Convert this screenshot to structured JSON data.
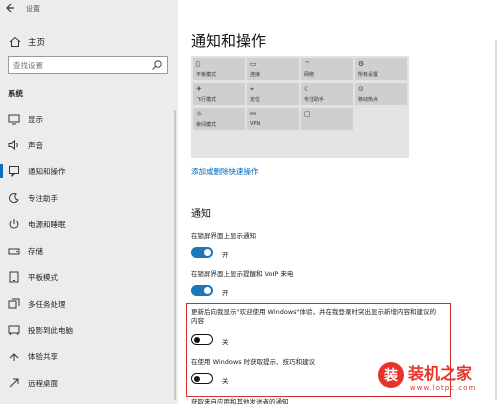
{
  "window": {
    "title": "设置"
  },
  "sidebar": {
    "home_label": "主页",
    "search_placeholder": "查找设置",
    "section_label": "系统",
    "items": [
      {
        "label": "显示",
        "icon": "display-icon"
      },
      {
        "label": "声音",
        "icon": "sound-icon"
      },
      {
        "label": "通知和操作",
        "icon": "notifications-icon",
        "selected": true
      },
      {
        "label": "专注助手",
        "icon": "focus-assist-icon"
      },
      {
        "label": "电源和睡眠",
        "icon": "power-icon"
      },
      {
        "label": "存储",
        "icon": "storage-icon"
      },
      {
        "label": "平板模式",
        "icon": "tablet-mode-icon"
      },
      {
        "label": "多任务处理",
        "icon": "multitasking-icon"
      },
      {
        "label": "投影到此电脑",
        "icon": "project-icon"
      },
      {
        "label": "体验共享",
        "icon": "shared-experiences-icon"
      },
      {
        "label": "远程桌面",
        "icon": "remote-desktop-icon"
      }
    ]
  },
  "main": {
    "title": "通知和操作",
    "quick_actions": [
      {
        "label": "平板模式"
      },
      {
        "label": "连接"
      },
      {
        "label": "网络"
      },
      {
        "label": "所有设置"
      },
      {
        "label": "飞行模式"
      },
      {
        "label": "定位"
      },
      {
        "label": "专注助手"
      },
      {
        "label": "移动热点"
      },
      {
        "label": "夜间模式"
      },
      {
        "label": "VPN"
      },
      {
        "label": ""
      }
    ],
    "edit_link": "添加或删除快速操作",
    "notifications_heading": "通知",
    "settings": [
      {
        "label": "在锁屏界面上显示通知",
        "state": "开",
        "on": true
      },
      {
        "label": "在锁屏界面上显示提醒和 VoIP 来电",
        "state": "开",
        "on": true
      },
      {
        "label": "更新后向我显示\"欢迎使用 Windows\"体验，并在我登录时突出显示新增内容和建议的内容",
        "state": "关",
        "on": false
      },
      {
        "label": "在使用 Windows 时获取提示、技巧和建议",
        "state": "关",
        "on": false
      }
    ],
    "cut_off_label": "获取来自应用和其他发送者的通知"
  },
  "watermark": {
    "text": "装机之家",
    "url": "www.lotpc.com"
  }
}
